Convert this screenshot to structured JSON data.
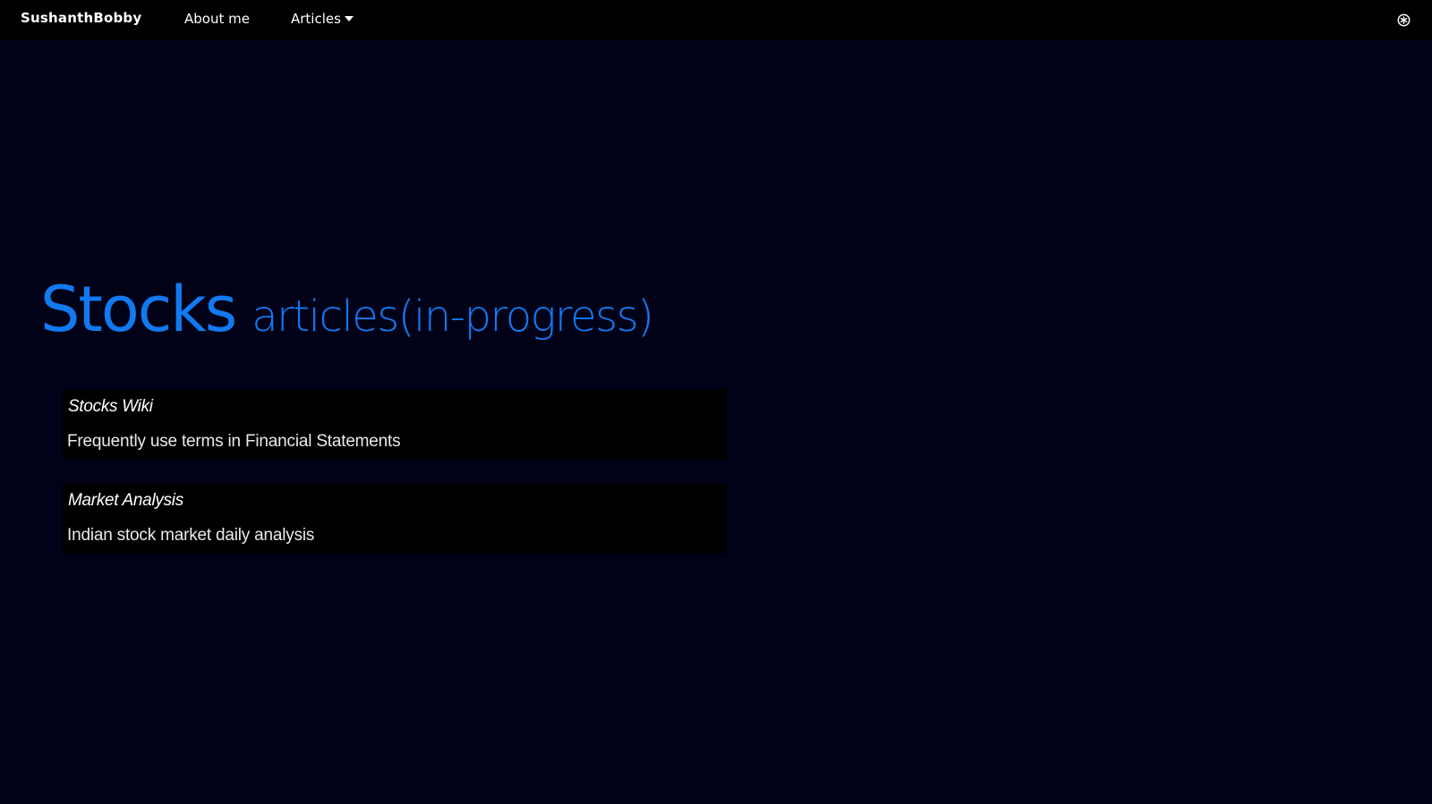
{
  "navbar": {
    "brand": "SushanthBobby",
    "links": [
      {
        "label": "About me"
      },
      {
        "label": "Articles"
      }
    ],
    "theme_icon": "theme-toggle-icon"
  },
  "hero": {
    "title": "Stocks",
    "subtitle": "articles(in-progress)"
  },
  "articles": [
    {
      "title": "Stocks Wiki",
      "description": "Frequently use terms in Financial Statements"
    },
    {
      "title": "Market Analysis",
      "description": "Indian stock market daily analysis"
    }
  ],
  "colors": {
    "background": "#010218",
    "navbar": "#000000",
    "accent": "#1279f0",
    "card": "#000000",
    "text": "#ffffff"
  }
}
